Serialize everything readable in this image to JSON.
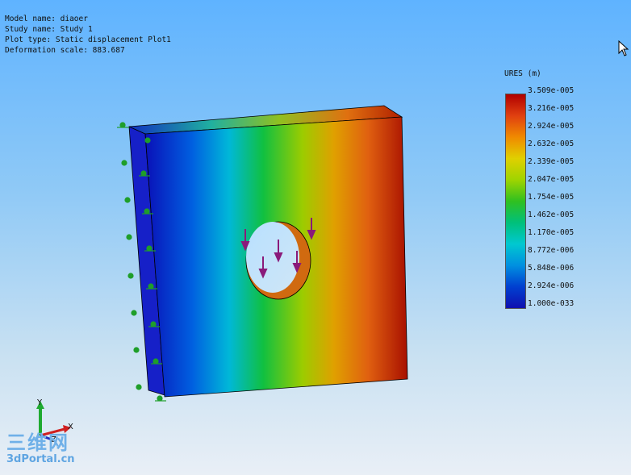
{
  "info": {
    "model": "Model name: diaoer",
    "study": "Study name: Study 1",
    "plot_type": "Plot type: Static displacement Plot1",
    "deformation": "Deformation scale: 883.687"
  },
  "legend": {
    "title": "URES (m)",
    "ticks": [
      "3.509e-005",
      "3.216e-005",
      "2.924e-005",
      "2.632e-005",
      "2.339e-005",
      "2.047e-005",
      "1.754e-005",
      "1.462e-005",
      "1.170e-005",
      "8.772e-006",
      "5.848e-006",
      "2.924e-006",
      "1.000e-033"
    ]
  },
  "axes": {
    "x": "X",
    "y": "Y",
    "z": "Z"
  },
  "watermark": {
    "cn": "三维网",
    "en": "3dPortal.cn"
  },
  "colors": {
    "fixture": "#1f9e2a",
    "load": "#8a1a7a",
    "background_top": "#5fb3ff"
  }
}
